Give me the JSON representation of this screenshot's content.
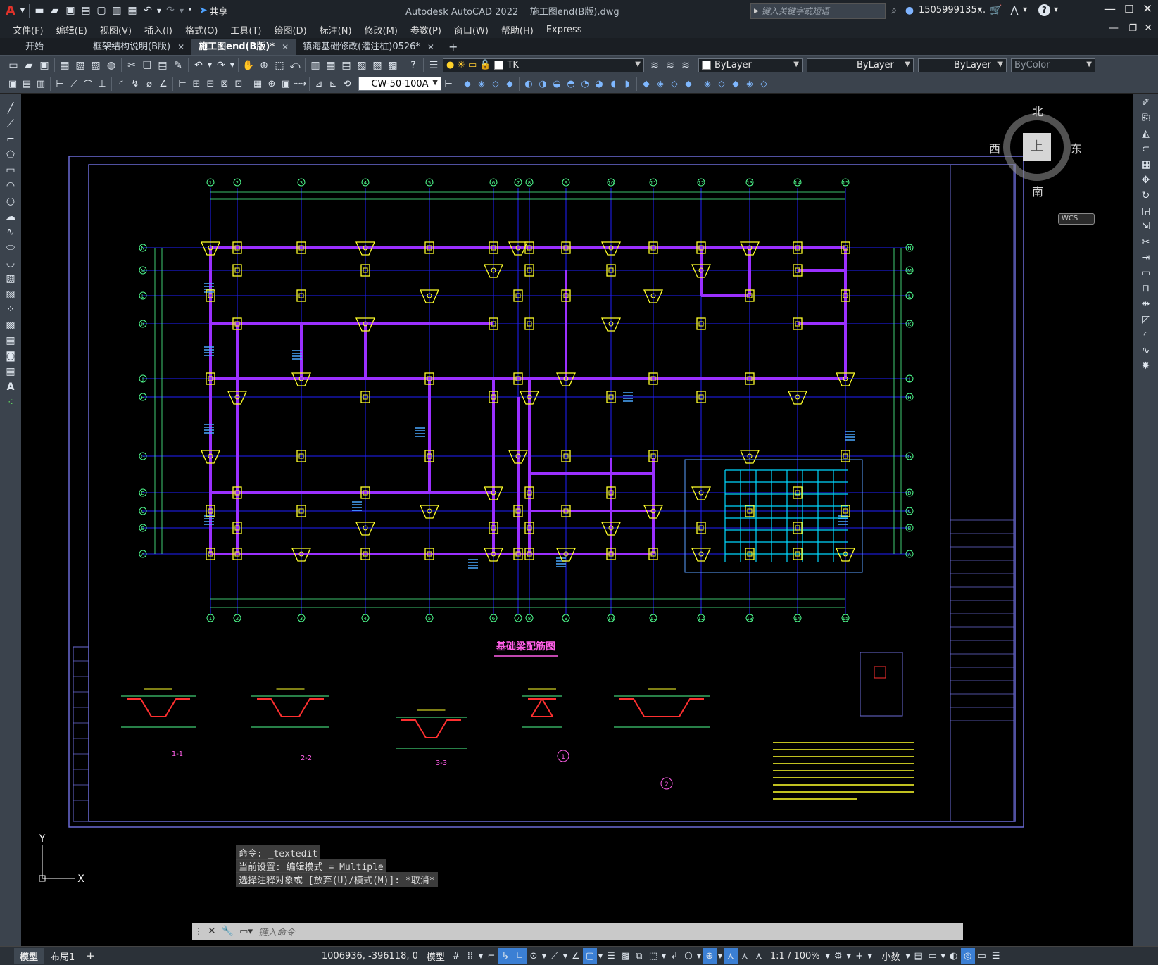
{
  "titlebar": {
    "app_letter": "A",
    "share_label": "共享",
    "title": "Autodesk AutoCAD 2022    施工图end(B版).dwg",
    "search_placeholder": "键入关键字或短语",
    "user": "1505999135...",
    "help": "?"
  },
  "menu": [
    "文件(F)",
    "编辑(E)",
    "视图(V)",
    "插入(I)",
    "格式(O)",
    "工具(T)",
    "绘图(D)",
    "标注(N)",
    "修改(M)",
    "参数(P)",
    "窗口(W)",
    "帮助(H)",
    "Express"
  ],
  "tabs": [
    {
      "label": "开始",
      "active": false,
      "closable": false
    },
    {
      "label": "框架结构说明(B版)",
      "active": false,
      "closable": true
    },
    {
      "label": "施工图end(B版)*",
      "active": true,
      "closable": true
    },
    {
      "label": "镇海基础修改(灌注桩)0526*",
      "active": false,
      "closable": true
    }
  ],
  "toolbar": {
    "layer_value": "TK",
    "color_value": "ByLayer",
    "linetype_value": "ByLayer",
    "lineweight_value": "ByLayer",
    "plotstyle_value": "ByColor",
    "dimstyle_value": "CW-50-100A"
  },
  "viewcube": {
    "north": "北",
    "south": "南",
    "east": "东",
    "west": "西",
    "top": "上",
    "wcs": "WCS"
  },
  "drawing": {
    "title": "基础梁配筋图",
    "section_labels": [
      "1-1",
      "2-2",
      "3-3"
    ],
    "detail_labels": [
      "1",
      "2"
    ],
    "row_axes": [
      "N",
      "M",
      "L",
      "K",
      "J",
      "H",
      "G",
      "D",
      "C",
      "B",
      "A"
    ],
    "col_axes": [
      "1",
      "2",
      "3",
      "4",
      "5",
      "6",
      "7",
      "8",
      "9",
      "10",
      "11",
      "12",
      "13",
      "14",
      "15",
      "16"
    ]
  },
  "command": {
    "history": [
      "命令: _textedit",
      "当前设置: 编辑模式 = Multiple",
      "选择注释对象或 [放弃(U)/模式(M)]: *取消*"
    ],
    "placeholder": "键入命令"
  },
  "status": {
    "coords": "1006936, -396118, 0",
    "model_label": "模型",
    "scale": "1:1 / 100%",
    "units": "小数",
    "layout_tabs": [
      "模型",
      "布局1"
    ]
  }
}
